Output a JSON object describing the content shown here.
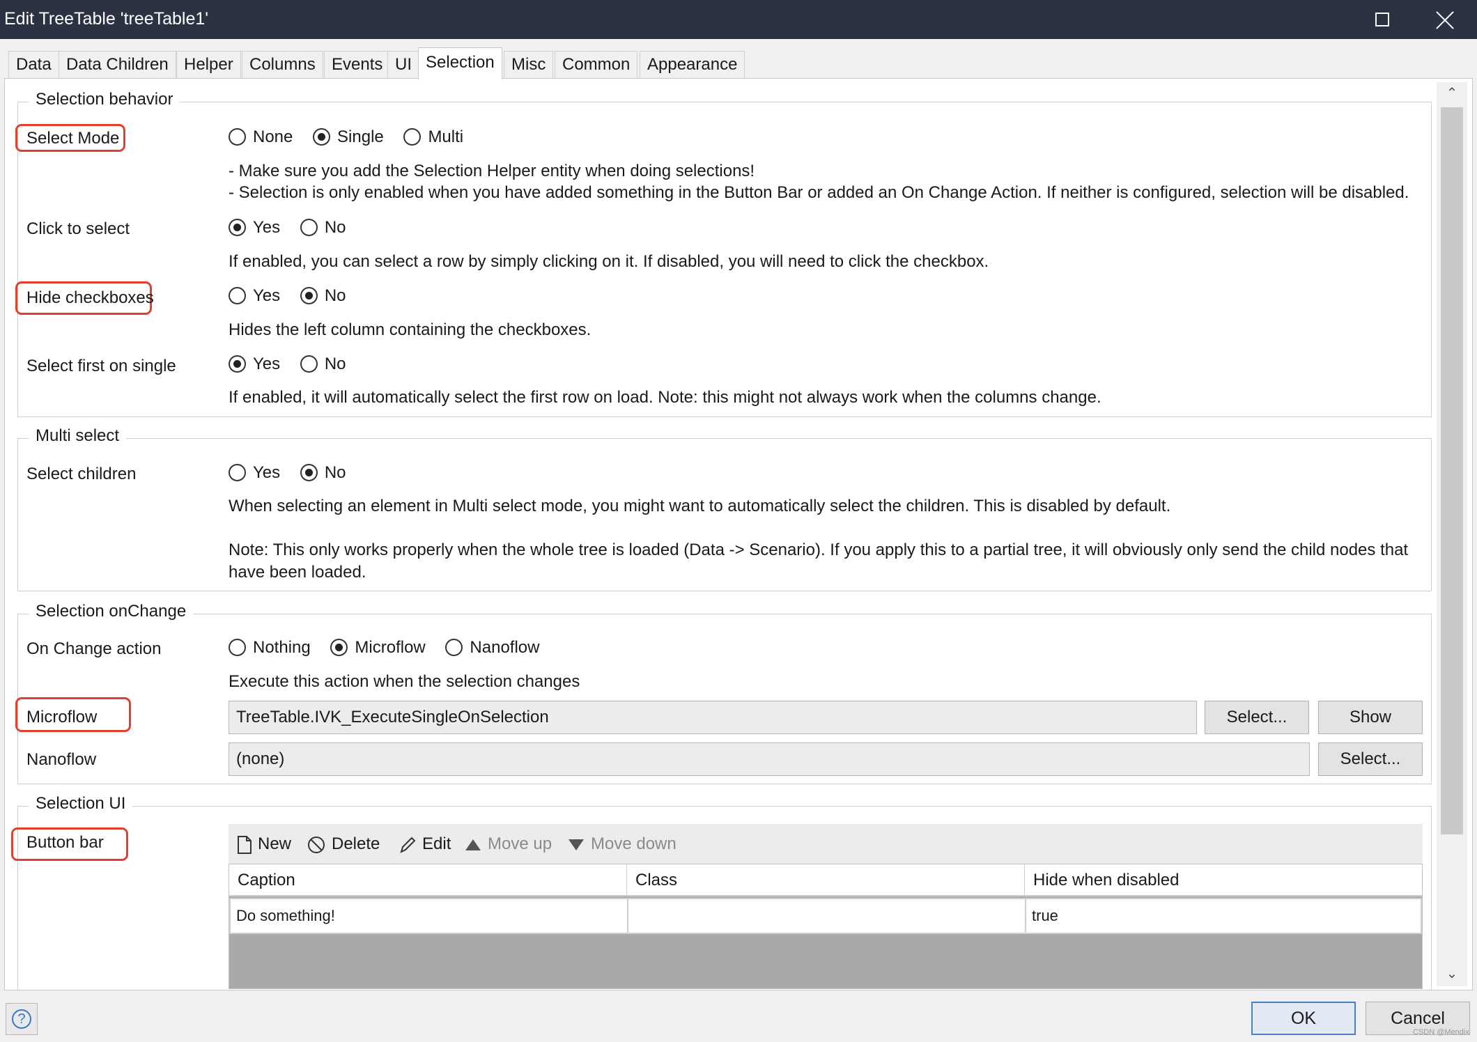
{
  "window": {
    "title": "Edit TreeTable 'treeTable1'"
  },
  "tabs": [
    {
      "label": "Data"
    },
    {
      "label": "Data Children"
    },
    {
      "label": "Helper"
    },
    {
      "label": "Columns"
    },
    {
      "label": "Events"
    },
    {
      "label": "UI"
    },
    {
      "label": "Selection"
    },
    {
      "label": "Misc"
    },
    {
      "label": "Common"
    },
    {
      "label": "Appearance"
    }
  ],
  "active_tab": "Selection",
  "selection_behavior": {
    "title": "Selection behavior",
    "select_mode": {
      "label": "Select Mode",
      "options": [
        "None",
        "Single",
        "Multi"
      ],
      "selected": "Single",
      "desc1": "- Make sure you add the Selection Helper entity when doing selections!",
      "desc2": "- Selection is only enabled when you have added something in the Button Bar or added an On Change Action. If neither is configured, selection will be disabled."
    },
    "click_to_select": {
      "label": "Click to select",
      "options": [
        "Yes",
        "No"
      ],
      "selected": "Yes",
      "desc": "If enabled, you can select a row by simply clicking on it. If disabled, you will need to click the checkbox."
    },
    "hide_checkboxes": {
      "label": "Hide checkboxes",
      "options": [
        "Yes",
        "No"
      ],
      "selected": "No",
      "desc": "Hides the left column containing the checkboxes."
    },
    "select_first": {
      "label": "Select first on single",
      "options": [
        "Yes",
        "No"
      ],
      "selected": "Yes",
      "desc": "If enabled, it will automatically select the first row on load. Note: this might not always work when the columns change."
    }
  },
  "multi_select": {
    "title": "Multi select",
    "select_children": {
      "label": "Select children",
      "options": [
        "Yes",
        "No"
      ],
      "selected": "No",
      "desc1": "When selecting an element in Multi select mode, you might want to automatically select the children. This is disabled by default.",
      "desc2": "Note: This only works properly when the whole tree is loaded (Data -> Scenario). If you apply this to a partial tree, it will obviously only send the child nodes that",
      "desc3": "have been loaded."
    }
  },
  "selection_onchange": {
    "title": "Selection onChange",
    "on_change_action": {
      "label": "On Change action",
      "options": [
        "Nothing",
        "Microflow",
        "Nanoflow"
      ],
      "selected": "Microflow",
      "desc": "Execute this action when the selection changes"
    },
    "microflow": {
      "label": "Microflow",
      "value": "TreeTable.IVK_ExecuteSingleOnSelection",
      "select_label": "Select...",
      "show_label": "Show"
    },
    "nanoflow": {
      "label": "Nanoflow",
      "value": "(none)",
      "select_label": "Select..."
    }
  },
  "selection_ui": {
    "title": "Selection UI",
    "button_bar": {
      "label": "Button bar"
    },
    "toolbar": {
      "new": "New",
      "delete": "Delete",
      "edit": "Edit",
      "move_up": "Move up",
      "move_down": "Move down"
    },
    "columns": [
      "Caption",
      "Class",
      "Hide when disabled"
    ],
    "rows": [
      {
        "caption": "Do something!",
        "class": "",
        "hide_when_disabled": "true"
      }
    ]
  },
  "footer": {
    "ok": "OK",
    "cancel": "Cancel",
    "help_icon": "question-mark-icon"
  },
  "watermark": "CSDN @Mendix",
  "colors": {
    "titlebar": "#2b3242",
    "highlight": "#e0402e",
    "ok_border": "#4a7fc8"
  }
}
